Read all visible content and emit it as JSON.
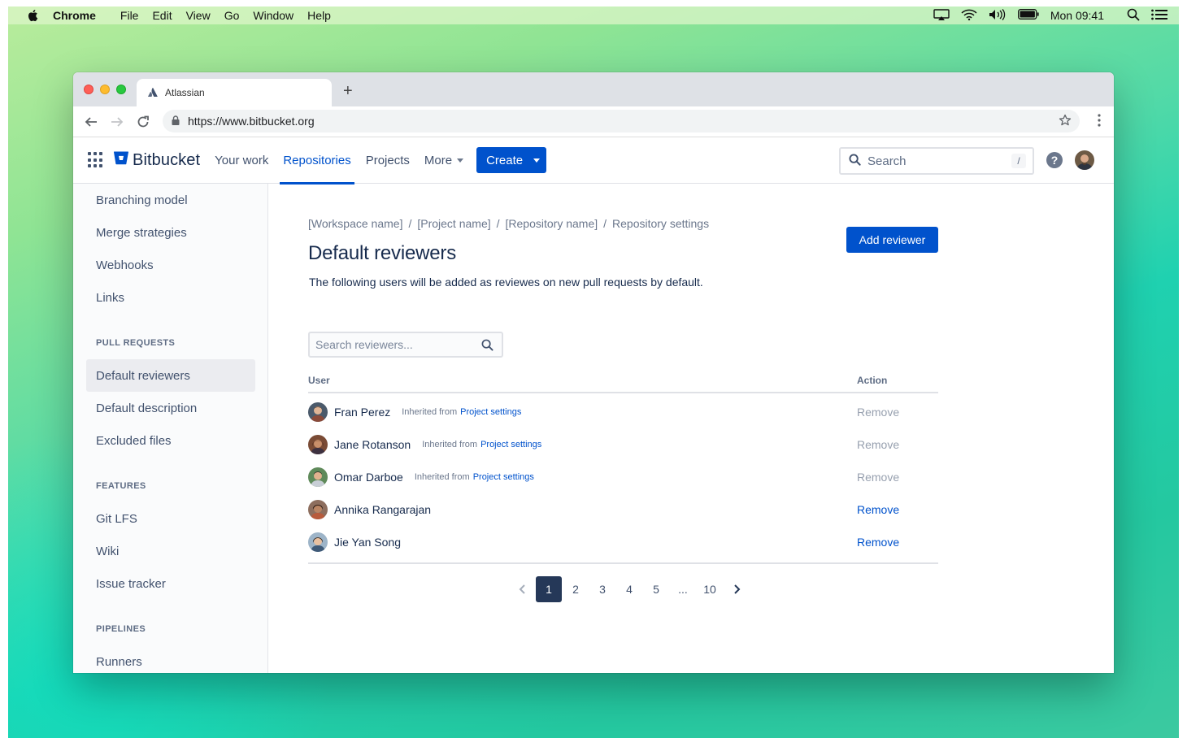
{
  "menubar": {
    "app_name": "Chrome",
    "items": [
      "File",
      "Edit",
      "View",
      "Go",
      "Window",
      "Help"
    ],
    "clock": "Mon 09:41"
  },
  "browser": {
    "tab_title": "Atlassian",
    "url": "https://www.bitbucket.org"
  },
  "header": {
    "logo_text": "Bitbucket",
    "nav": {
      "your_work": "Your work",
      "repositories": "Repositories",
      "projects": "Projects",
      "more": "More"
    },
    "create_label": "Create",
    "search_placeholder": "Search",
    "search_shortcut": "/",
    "help_glyph": "?"
  },
  "sidebar": {
    "top_items": [
      "Branching model",
      "Merge strategies",
      "Webhooks",
      "Links"
    ],
    "sections": [
      {
        "heading": "PULL REQUESTS",
        "items": [
          "Default reviewers",
          "Default description",
          "Excluded files"
        ]
      },
      {
        "heading": "FEATURES",
        "items": [
          "Git LFS",
          "Wiki",
          "Issue tracker"
        ]
      },
      {
        "heading": "PIPELINES",
        "items": [
          "Runners"
        ]
      }
    ],
    "selected": "Default reviewers"
  },
  "main": {
    "breadcrumb": [
      "[Workspace name]",
      "[Project name]",
      "[Repository name]",
      "Repository settings"
    ],
    "breadcrumb_separator": "/",
    "title": "Default reviewers",
    "description": "The following users will be added as reviewes on new pull requests by default.",
    "add_button": "Add reviewer",
    "search_placeholder": "Search reviewers...",
    "table": {
      "col_user": "User",
      "col_action": "Action",
      "inherited_prefix": "Inherited from",
      "inherited_link": "Project settings",
      "remove_label": "Remove",
      "rows": [
        {
          "name": "Fran Perez",
          "inherited": true
        },
        {
          "name": "Jane Rotanson",
          "inherited": true
        },
        {
          "name": "Omar Darboe",
          "inherited": true
        },
        {
          "name": "Annika Rangarajan",
          "inherited": false
        },
        {
          "name": "Jie Yan Song",
          "inherited": false
        }
      ]
    },
    "pagination": {
      "pages": [
        "1",
        "2",
        "3",
        "4",
        "5",
        "...",
        "10"
      ],
      "current": "1"
    }
  },
  "colors": {
    "brand_blue": "#0052cc",
    "pager_current": "#253858",
    "sidebar_bg": "#fafbfc"
  }
}
